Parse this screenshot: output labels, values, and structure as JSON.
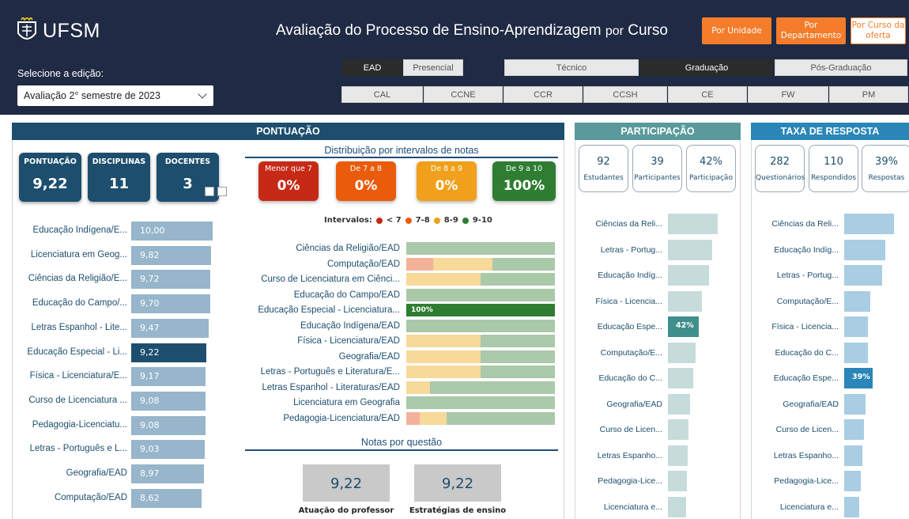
{
  "header": {
    "logo_text": "UFSM",
    "title_main": "Avaliação do Processo de Ensino-Aprendizagem",
    "title_por": "por",
    "title_curso": "Curso",
    "buttons": [
      "Por Unidade",
      "Por Departamento",
      "Por Curso da oferta"
    ],
    "edition_label": "Selecione a edição:",
    "edition_value": "Avaliação 2° semestre de 2023",
    "modality": [
      "EAD",
      "Presencial"
    ],
    "levels": [
      "Técnico",
      "Graduação",
      "Pós-Graduação"
    ],
    "units": [
      "CAL",
      "CCNE",
      "CCR",
      "CCSH",
      "CE",
      "FW",
      "PM"
    ]
  },
  "pontuacao": {
    "title": "PONTUAÇÃO",
    "kpis": [
      {
        "label": "PONTUAÇÃO",
        "value": "9,22"
      },
      {
        "label": "DISCIPLINAS",
        "value": "11"
      },
      {
        "label": "DOCENTES",
        "value": "3"
      }
    ],
    "dist_title": "Distribuição por intervalos de notas",
    "dist_cards": [
      {
        "label": "Menor que 7",
        "value": "0%",
        "color": "#c62a16"
      },
      {
        "label": "De 7 a 8",
        "value": "0%",
        "color": "#ea5b0c"
      },
      {
        "label": "De 8 a 9",
        "value": "0%",
        "color": "#f0a01a"
      },
      {
        "label": "De 9 a 10",
        "value": "100%",
        "color": "#2e7d32"
      }
    ],
    "legend": {
      "label": "Intervalos:",
      "items": [
        "< 7",
        "7-8",
        "8-9",
        "9-10"
      ],
      "colors": [
        "#c62a16",
        "#ea5b0c",
        "#f0a01a",
        "#2e7d32"
      ]
    },
    "scores": [
      {
        "name": "Educação Indígena/E...",
        "value": "10,00",
        "num": 10.0
      },
      {
        "name": "Licenciatura em Geog...",
        "value": "9,82",
        "num": 9.82
      },
      {
        "name": "Ciências da Religião/E...",
        "value": "9,72",
        "num": 9.72
      },
      {
        "name": "Educação do Campo/...",
        "value": "9,70",
        "num": 9.7
      },
      {
        "name": "Letras Espanhol - Lite...",
        "value": "9,47",
        "num": 9.47
      },
      {
        "name": "Educação Especial - Li...",
        "value": "9,22",
        "num": 9.22,
        "highlight": true
      },
      {
        "name": "Física - Licenciatura/E...",
        "value": "9,17",
        "num": 9.17
      },
      {
        "name": "Curso de Licenciatura ...",
        "value": "9,08",
        "num": 9.08
      },
      {
        "name": "Pedagogia-Licenciatu...",
        "value": "9,08",
        "num": 9.08
      },
      {
        "name": "Letras - Português e L...",
        "value": "9,03",
        "num": 9.03
      },
      {
        "name": "Geografia/EAD",
        "value": "8,97",
        "num": 8.97
      },
      {
        "name": "Computação/EAD",
        "value": "8,62",
        "num": 8.62
      }
    ],
    "stacks": [
      {
        "name": "Ciências da Religião/EAD",
        "segs": [
          0,
          0,
          0,
          100
        ]
      },
      {
        "name": "Computação/EAD",
        "segs": [
          0,
          18,
          40,
          42
        ]
      },
      {
        "name": "Curso de Licenciatura em Ciênci...",
        "segs": [
          0,
          0,
          50,
          50
        ]
      },
      {
        "name": "Educação do Campo/EAD",
        "segs": [
          0,
          0,
          0,
          100
        ]
      },
      {
        "name": "Educação Especial - Licenciatura...",
        "segs": [
          0,
          0,
          0,
          100
        ],
        "label": "100%",
        "highlight": true
      },
      {
        "name": "Educação Indígena/EAD",
        "segs": [
          0,
          0,
          0,
          100
        ]
      },
      {
        "name": "Física - Licenciatura/EAD",
        "segs": [
          0,
          0,
          50,
          50
        ]
      },
      {
        "name": "Geografia/EAD",
        "segs": [
          0,
          0,
          50,
          50
        ]
      },
      {
        "name": "Letras - Português e Literatura/E...",
        "segs": [
          0,
          0,
          50,
          50
        ]
      },
      {
        "name": "Letras Espanhol - Literaturas/EAD",
        "segs": [
          0,
          0,
          16,
          84
        ]
      },
      {
        "name": "Licenciatura em Geografia",
        "segs": [
          0,
          0,
          0,
          100
        ]
      },
      {
        "name": "Pedagogia-Licenciatura/EAD",
        "segs": [
          0,
          9,
          18,
          73
        ]
      }
    ],
    "notas_title": "Notas por questão",
    "questions": [
      {
        "value": "9,22",
        "label": "Atuação do professor"
      },
      {
        "value": "9,22",
        "label": "Estratégias de ensino"
      }
    ]
  },
  "participacao": {
    "title": "PARTICIPAÇÃO",
    "cards": [
      {
        "value": "92",
        "label": "Estudantes"
      },
      {
        "value": "39",
        "label": "Participantes"
      },
      {
        "value": "42%",
        "label": "Participação"
      }
    ],
    "bars": [
      {
        "name": "Ciências da Reli...",
        "pct": 68
      },
      {
        "name": "Letras - Portug...",
        "pct": 60
      },
      {
        "name": "Educação Indíg...",
        "pct": 56
      },
      {
        "name": "Física - Licencia...",
        "pct": 46
      },
      {
        "name": "Educação Espe...",
        "pct": 42,
        "label": "42%",
        "highlight": true
      },
      {
        "name": "Computação/E...",
        "pct": 38
      },
      {
        "name": "Educação do C...",
        "pct": 34
      },
      {
        "name": "Geografia/EAD",
        "pct": 30
      },
      {
        "name": "Curso de Licen...",
        "pct": 28
      },
      {
        "name": "Letras Espanho...",
        "pct": 27
      },
      {
        "name": "Pedagogia-Lice...",
        "pct": 26
      },
      {
        "name": "Licenciatura e...",
        "pct": 25
      }
    ]
  },
  "taxa": {
    "title": "TAXA DE RESPOSTA",
    "cards": [
      {
        "value": "282",
        "label": "Questionários"
      },
      {
        "value": "110",
        "label": "Respondidos"
      },
      {
        "value": "39%",
        "label": "Respostas"
      }
    ],
    "bars": [
      {
        "name": "Ciências da Reli...",
        "pct": 68
      },
      {
        "name": "Educação Indíg...",
        "pct": 56
      },
      {
        "name": "Letras - Portug...",
        "pct": 52
      },
      {
        "name": "Computação/E...",
        "pct": 36
      },
      {
        "name": "Física - Licencia...",
        "pct": 32
      },
      {
        "name": "Educação do C...",
        "pct": 32
      },
      {
        "name": "Educação Espe...",
        "pct": 39,
        "label": "39%",
        "highlight": true
      },
      {
        "name": "Geografia/EAD",
        "pct": 29
      },
      {
        "name": "Curso de Licen...",
        "pct": 27
      },
      {
        "name": "Letras Espanho...",
        "pct": 25
      },
      {
        "name": "Pedagogia-Lice...",
        "pct": 23
      },
      {
        "name": "Licenciatura e...",
        "pct": 21
      }
    ]
  },
  "colors": {
    "header_bg": "#1f2a44",
    "panel_blue": "#1d4e6e",
    "panel_teal": "#5a9a9c",
    "panel_cyan": "#2a86b8",
    "part_bar": "#c6dcda",
    "part_bar_hl": "#3f8f8c",
    "taxa_bar": "#a9cde3",
    "taxa_bar_hl": "#2a86b8"
  }
}
